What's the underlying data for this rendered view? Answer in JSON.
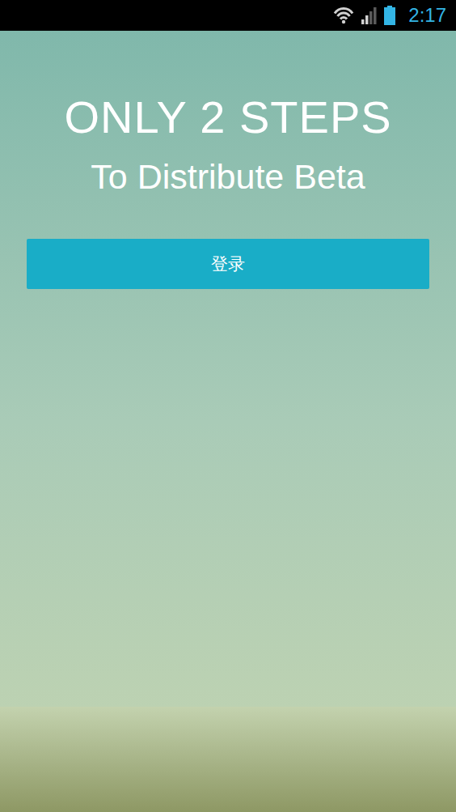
{
  "status_bar": {
    "time": "2:17",
    "wifi": {
      "level": 1.0
    },
    "signal": {
      "level": 0.5
    },
    "battery": {
      "level": 1.0
    }
  },
  "headline": {
    "title": "ONLY 2 STEPS",
    "subtitle": "To Distribute Beta"
  },
  "login_button": {
    "label": "登录"
  }
}
